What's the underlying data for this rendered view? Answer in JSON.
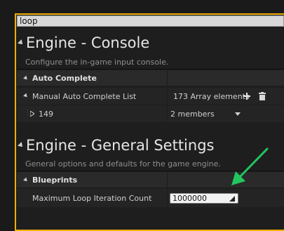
{
  "search": {
    "value": "loop"
  },
  "console_section": {
    "title": "Engine - Console",
    "description": "Configure the in-game input console.",
    "auto_complete": {
      "label": "Auto Complete",
      "manual_list_label": "Manual Auto Complete List",
      "manual_list_value": "173 Array elements",
      "entry_index": "149",
      "entry_value": "2 members"
    }
  },
  "general_section": {
    "title": "Engine - General Settings",
    "description": "General options and defaults for the game engine.",
    "blueprints": {
      "label": "Blueprints",
      "loop_label": "Maximum Loop Iteration Count",
      "loop_value": "1000000"
    }
  },
  "colors": {
    "highlight": "#f0b000",
    "arrow": "#22c55e"
  }
}
